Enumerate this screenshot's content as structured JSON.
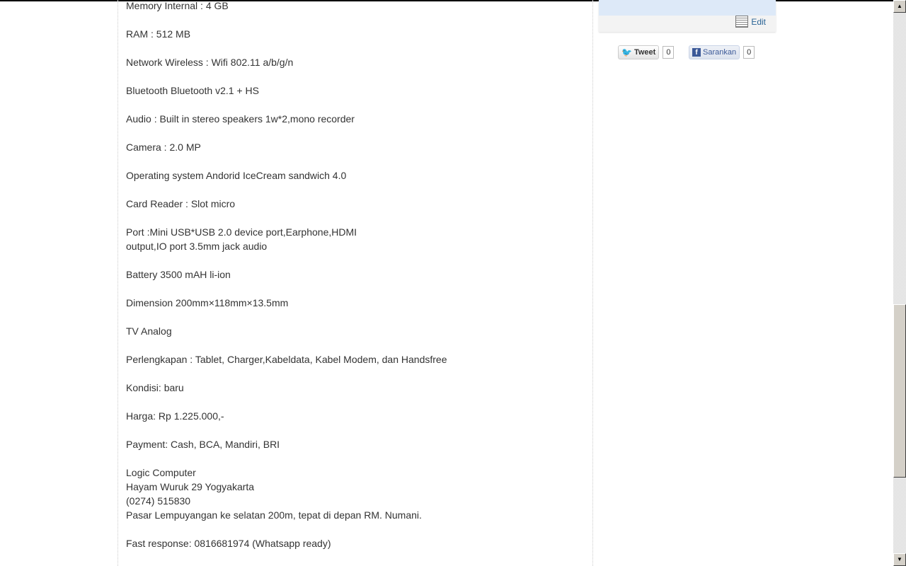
{
  "post": {
    "lines": [
      "Memory Internal : 4 GB",
      "RAM : 512 MB",
      "Network Wireless : Wifi 802.11 a/b/g/n",
      "Bluetooth Bluetooth v2.1 + HS",
      "Audio : Built in stereo speakers 1w*2,mono recorder",
      "Camera : 2.0 MP",
      "Operating system Andorid IceCream sandwich 4.0",
      "Card Reader : Slot micro",
      "Port :Mini USB*USB 2.0 device port,Earphone,HDMI",
      "output,IO port 3.5mm jack audio",
      "Battery 3500 mAH li-ion",
      "Dimension 200mm×118mm×13.5mm",
      "TV Analog",
      "Perlengkapan : Tablet, Charger,Kabeldata, Kabel Modem, dan Handsfree",
      "Kondisi: baru",
      "Harga: Rp 1.225.000,-",
      "Payment: Cash, BCA, Mandiri, BRI",
      "Logic Computer",
      "Hayam Wuruk 29 Yogyakarta",
      "(0274) 515830",
      "Pasar Lempuyangan ke selatan 200m, tepat di depan RM. Numani.",
      "Fast response: 0816681974 (Whatsapp ready)"
    ]
  },
  "sidebar": {
    "edit_label": "Edit",
    "tweet_label": "Tweet",
    "tweet_count": "0",
    "facebook_label": "Sarankan",
    "facebook_count": "0"
  }
}
